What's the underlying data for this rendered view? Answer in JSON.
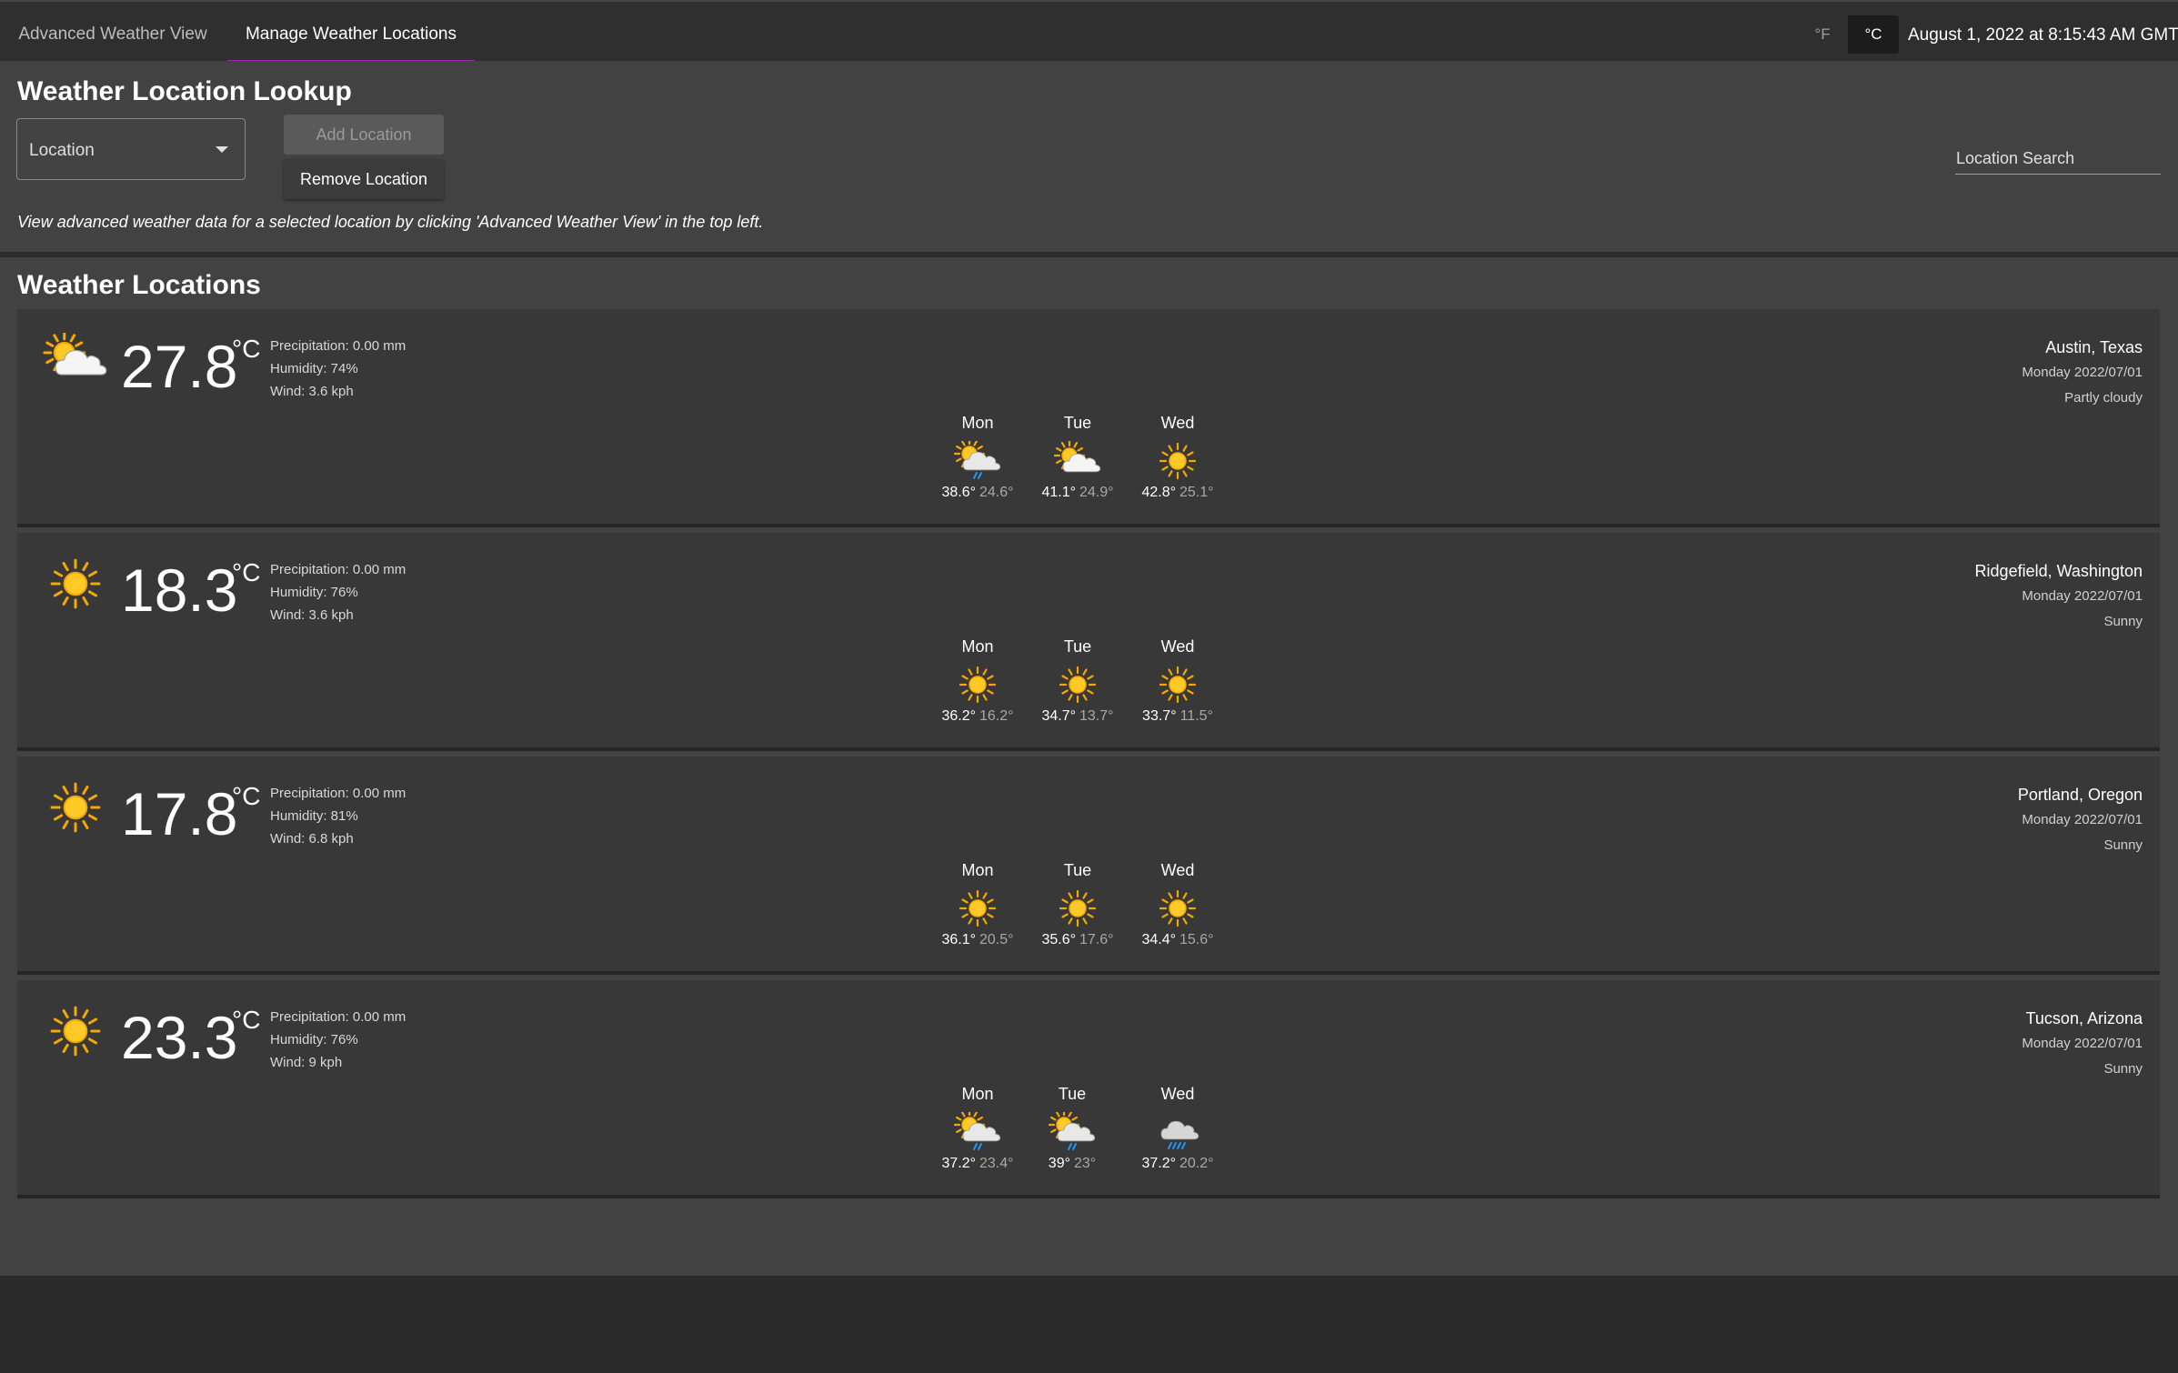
{
  "tabs": [
    {
      "label": "Advanced Weather View",
      "active": false
    },
    {
      "label": "Manage Weather Locations",
      "active": true
    }
  ],
  "units": {
    "f": "°F",
    "c": "°C",
    "selected": "°C"
  },
  "clock": "August 1, 2022 at 8:15:43 AM GMT-7",
  "lookup": {
    "title": "Weather Location Lookup",
    "select_value": "Location",
    "add_label": "Add Location",
    "remove_label": "Remove Location",
    "search_placeholder": "Location Search",
    "hint": "View advanced weather data for a selected location by clicking 'Advanced Weather View' in the top left."
  },
  "locations_title": "Weather Locations",
  "colors": {
    "accent": "#9c27b0",
    "sun": "#ffc107",
    "rain": "#2196f3"
  },
  "cards": [
    {
      "icon": "partly-cloudy-icon",
      "temp": "27.8",
      "unit": "°C",
      "precip": "Precipitation: 0.00 mm",
      "humidity": "Humidity: 74%",
      "wind": "Wind: 3.6 kph",
      "name": "Austin, Texas",
      "date": "Monday 2022/07/01",
      "condition": "Partly cloudy",
      "forecast": [
        {
          "day": "Mon",
          "icon": "partly-cloudy-rain-icon",
          "hi": "38.6°",
          "lo": "24.6°"
        },
        {
          "day": "Tue",
          "icon": "partly-cloudy-icon",
          "hi": "41.1°",
          "lo": "24.9°"
        },
        {
          "day": "Wed",
          "icon": "sun-icon",
          "hi": "42.8°",
          "lo": "25.1°"
        }
      ]
    },
    {
      "icon": "sun-icon",
      "temp": "18.3",
      "unit": "°C",
      "precip": "Precipitation: 0.00 mm",
      "humidity": "Humidity: 76%",
      "wind": "Wind: 3.6 kph",
      "name": "Ridgefield, Washington",
      "date": "Monday 2022/07/01",
      "condition": "Sunny",
      "forecast": [
        {
          "day": "Mon",
          "icon": "sun-icon",
          "hi": "36.2°",
          "lo": "16.2°"
        },
        {
          "day": "Tue",
          "icon": "sun-icon",
          "hi": "34.7°",
          "lo": "13.7°"
        },
        {
          "day": "Wed",
          "icon": "sun-icon",
          "hi": "33.7°",
          "lo": "11.5°"
        }
      ]
    },
    {
      "icon": "sun-icon",
      "temp": "17.8",
      "unit": "°C",
      "precip": "Precipitation: 0.00 mm",
      "humidity": "Humidity: 81%",
      "wind": "Wind: 6.8 kph",
      "name": "Portland, Oregon",
      "date": "Monday 2022/07/01",
      "condition": "Sunny",
      "forecast": [
        {
          "day": "Mon",
          "icon": "sun-icon",
          "hi": "36.1°",
          "lo": "20.5°"
        },
        {
          "day": "Tue",
          "icon": "sun-icon",
          "hi": "35.6°",
          "lo": "17.6°"
        },
        {
          "day": "Wed",
          "icon": "sun-icon",
          "hi": "34.4°",
          "lo": "15.6°"
        }
      ]
    },
    {
      "icon": "sun-icon",
      "temp": "23.3",
      "unit": "°C",
      "precip": "Precipitation: 0.00 mm",
      "humidity": "Humidity: 76%",
      "wind": "Wind: 9 kph",
      "name": "Tucson, Arizona",
      "date": "Monday 2022/07/01",
      "condition": "Sunny",
      "forecast": [
        {
          "day": "Mon",
          "icon": "partly-cloudy-rain-icon",
          "hi": "37.2°",
          "lo": "23.4°"
        },
        {
          "day": "Tue",
          "icon": "partly-cloudy-rain-icon",
          "hi": "39°",
          "lo": "23°"
        },
        {
          "day": "Wed",
          "icon": "cloud-heavy-rain-icon",
          "hi": "37.2°",
          "lo": "20.2°"
        }
      ]
    }
  ]
}
